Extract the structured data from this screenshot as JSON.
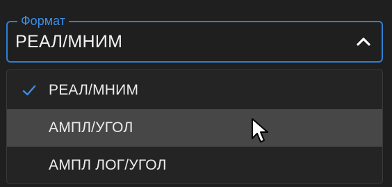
{
  "format_select": {
    "label": "Формат",
    "value": "РЕАЛ/МНИМ",
    "expanded": true,
    "toggle_icon": "chevron-up-icon",
    "accent_color": "#2f7fd6"
  },
  "menu": {
    "items": [
      {
        "label": "РЕАЛ/МНИМ",
        "selected": true,
        "hovered": false
      },
      {
        "label": "АМПЛ/УГОЛ",
        "selected": false,
        "hovered": true
      },
      {
        "label": "АМПЛ ЛОГ/УГОЛ",
        "selected": false,
        "hovered": false
      }
    ],
    "check_icon": "checkmark-icon",
    "hover_color": "#474747"
  },
  "pointer": {
    "icon": "mouse-cursor-icon"
  }
}
